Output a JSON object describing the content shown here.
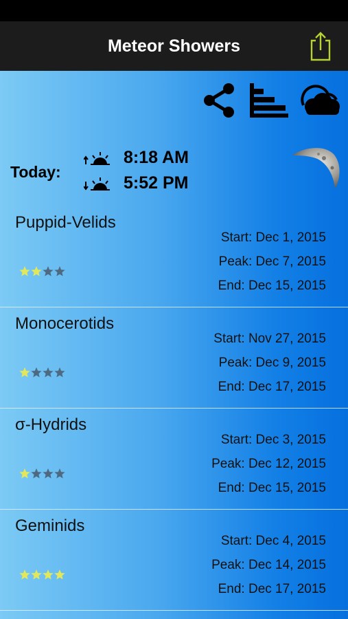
{
  "nav": {
    "title": "Meteor Showers",
    "share_icon": "share-box-icon"
  },
  "toolbar": [
    {
      "icon": "share-icon"
    },
    {
      "icon": "timeline-chart-icon"
    },
    {
      "icon": "cloud-weather-icon"
    }
  ],
  "today": {
    "label": "Today:",
    "sunrise": "8:18 AM",
    "sunset": "5:52 PM",
    "moon_phase": "waning-crescent"
  },
  "showers": [
    {
      "name": "Puppid-Velids",
      "rating": 2,
      "start": "Start: Dec 1, 2015",
      "peak": "Peak: Dec 7, 2015",
      "end": "End: Dec 15, 2015"
    },
    {
      "name": "Monocerotids",
      "rating": 1,
      "start": "Start: Nov 27, 2015",
      "peak": "Peak: Dec 9, 2015",
      "end": "End: Dec 17, 2015"
    },
    {
      "name": "σ-Hydrids",
      "rating": 1,
      "start": "Start: Dec 3, 2015",
      "peak": "Peak: Dec 12, 2015",
      "end": "End: Dec 15, 2015"
    },
    {
      "name": "Geminids",
      "rating": 4,
      "start": "Start: Dec 4, 2015",
      "peak": "Peak: Dec 14, 2015",
      "end": "End: Dec 17, 2015"
    }
  ],
  "colors": {
    "nav_bg": "#1c1c1c",
    "accent_green": "#b5d334",
    "star_on": "#e3e85a",
    "star_off": "#4d6a82"
  }
}
